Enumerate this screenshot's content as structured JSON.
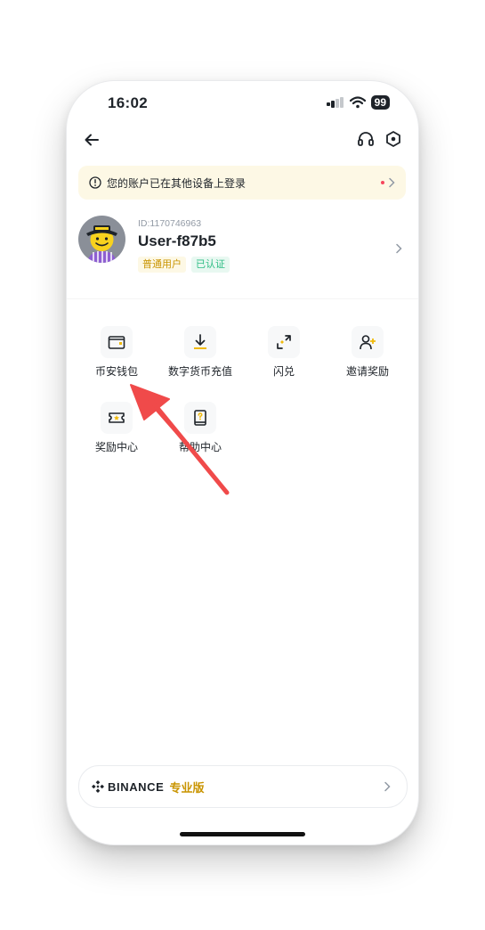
{
  "status_bar": {
    "time": "16:02",
    "battery": "99"
  },
  "notice": {
    "text": "您的账户已在其他设备上登录"
  },
  "profile": {
    "uid": "ID:1170746963",
    "username": "User-f87b5",
    "tag_normal": "普通用户",
    "tag_verified": "已认证"
  },
  "menu": {
    "items": [
      {
        "label": "币安钱包",
        "icon": "wallet-icon"
      },
      {
        "label": "数字货币充值",
        "icon": "download-icon"
      },
      {
        "label": "闪兑",
        "icon": "convert-icon"
      },
      {
        "label": "邀请奖励",
        "icon": "invite-user-icon"
      },
      {
        "label": "奖励中心",
        "icon": "reward-ticket-icon"
      },
      {
        "label": "帮助中心",
        "icon": "help-book-icon"
      }
    ]
  },
  "pro": {
    "brand": "BINANCE",
    "subtitle": "专业版"
  },
  "colors": {
    "accent": "#f0b90b",
    "gold_text": "#c99400",
    "green": "#2ebd85",
    "annotation_arrow": "#f04a4a"
  }
}
